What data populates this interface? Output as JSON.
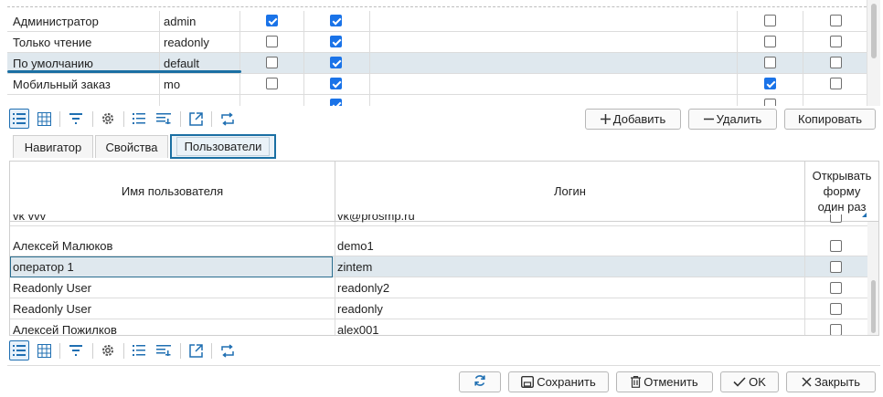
{
  "roles_grid": {
    "partial_top_text": "",
    "rows": [
      {
        "name": "Администратор",
        "code": "admin",
        "c1": true,
        "c2": true,
        "c3": false,
        "c4": false
      },
      {
        "name": "Только чтение",
        "code": "readonly",
        "c1": false,
        "c2": true,
        "c3": false,
        "c4": false
      },
      {
        "name": "По умолчанию",
        "code": "default",
        "c1": false,
        "c2": true,
        "c3": false,
        "c4": false,
        "selected": true
      },
      {
        "name": "Мобильный заказ",
        "code": "mo",
        "c1": false,
        "c2": true,
        "c3": true,
        "c4": false
      },
      {
        "name": "",
        "code": "",
        "c1": false,
        "c2": true,
        "c3": false,
        "c4": false
      }
    ]
  },
  "toolbar_icons": [
    "list-view-icon",
    "grid-view-icon",
    "filter-icon",
    "settings-icon",
    "ordered-list-icon",
    "group-list-icon",
    "export-icon",
    "swap-icon"
  ],
  "top_buttons": {
    "add_label": "Добавить",
    "delete_label": "Удалить",
    "copy_label": "Копировать"
  },
  "tabs": [
    {
      "label": "Навигатор"
    },
    {
      "label": "Свойства"
    },
    {
      "label": "Пользователи",
      "active": true
    }
  ],
  "users_grid": {
    "headers": {
      "name": "Имя пользователя",
      "login": "Логин",
      "open_once": "Открывать форму один раз"
    },
    "rows": [
      {
        "name": "vk vvv",
        "login": "vk@prosmp.ru",
        "open_once": false
      },
      {
        "name": "Алексей Малюков",
        "login": "demo1",
        "open_once": false
      },
      {
        "name": "оператор 1",
        "login": "zintem",
        "open_once": false,
        "selected": true
      },
      {
        "name": "Readonly User",
        "login": "readonly2",
        "open_once": false
      },
      {
        "name": "Readonly User",
        "login": "readonly",
        "open_once": false
      },
      {
        "name": "Алексей Пожилков",
        "login": "alex001",
        "open_once": false
      }
    ]
  },
  "bottom_buttons": {
    "refresh_icon": "refresh-icon",
    "save_label": "Сохранить",
    "cancel_label": "Отменить",
    "ok_label": "OK",
    "close_label": "Закрыть"
  },
  "colors": {
    "accent": "#1a6fa3",
    "checkbox_on": "#1a73e8",
    "selected_row": "#dfe8ee"
  }
}
